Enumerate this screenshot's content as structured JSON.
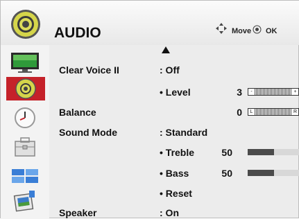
{
  "header": {
    "title": "AUDIO",
    "move_label": "Move",
    "ok_label": "OK"
  },
  "sidebar": {
    "items": [
      {
        "icon": "monitor-picture-icon",
        "active": false
      },
      {
        "icon": "audio-speaker-icon",
        "active": true
      },
      {
        "icon": "clock-icon",
        "active": false
      },
      {
        "icon": "option-toolbox-icon",
        "active": false
      },
      {
        "icon": "input-list-icon",
        "active": false
      },
      {
        "icon": "photo-media-icon",
        "active": false
      }
    ]
  },
  "menu": {
    "clear_voice": {
      "label": "Clear Voice II",
      "value": ": Off"
    },
    "level": {
      "label": "• Level",
      "value": "3",
      "percent": 0.48
    },
    "balance": {
      "label": "Balance",
      "value": "0",
      "left_tag": "L",
      "right_tag": "R"
    },
    "sound_mode": {
      "label": "Sound Mode",
      "value": ": Standard"
    },
    "treble": {
      "label": "• Treble",
      "value": "50",
      "percent": 0.5
    },
    "bass": {
      "label": "• Bass",
      "value": "50",
      "percent": 0.5
    },
    "reset": {
      "label": "• Reset"
    },
    "speaker": {
      "label": "Speaker",
      "value": ": On"
    }
  },
  "colors": {
    "active_highlight": "#c5222a",
    "bar_dark": "#4b4b4b"
  }
}
